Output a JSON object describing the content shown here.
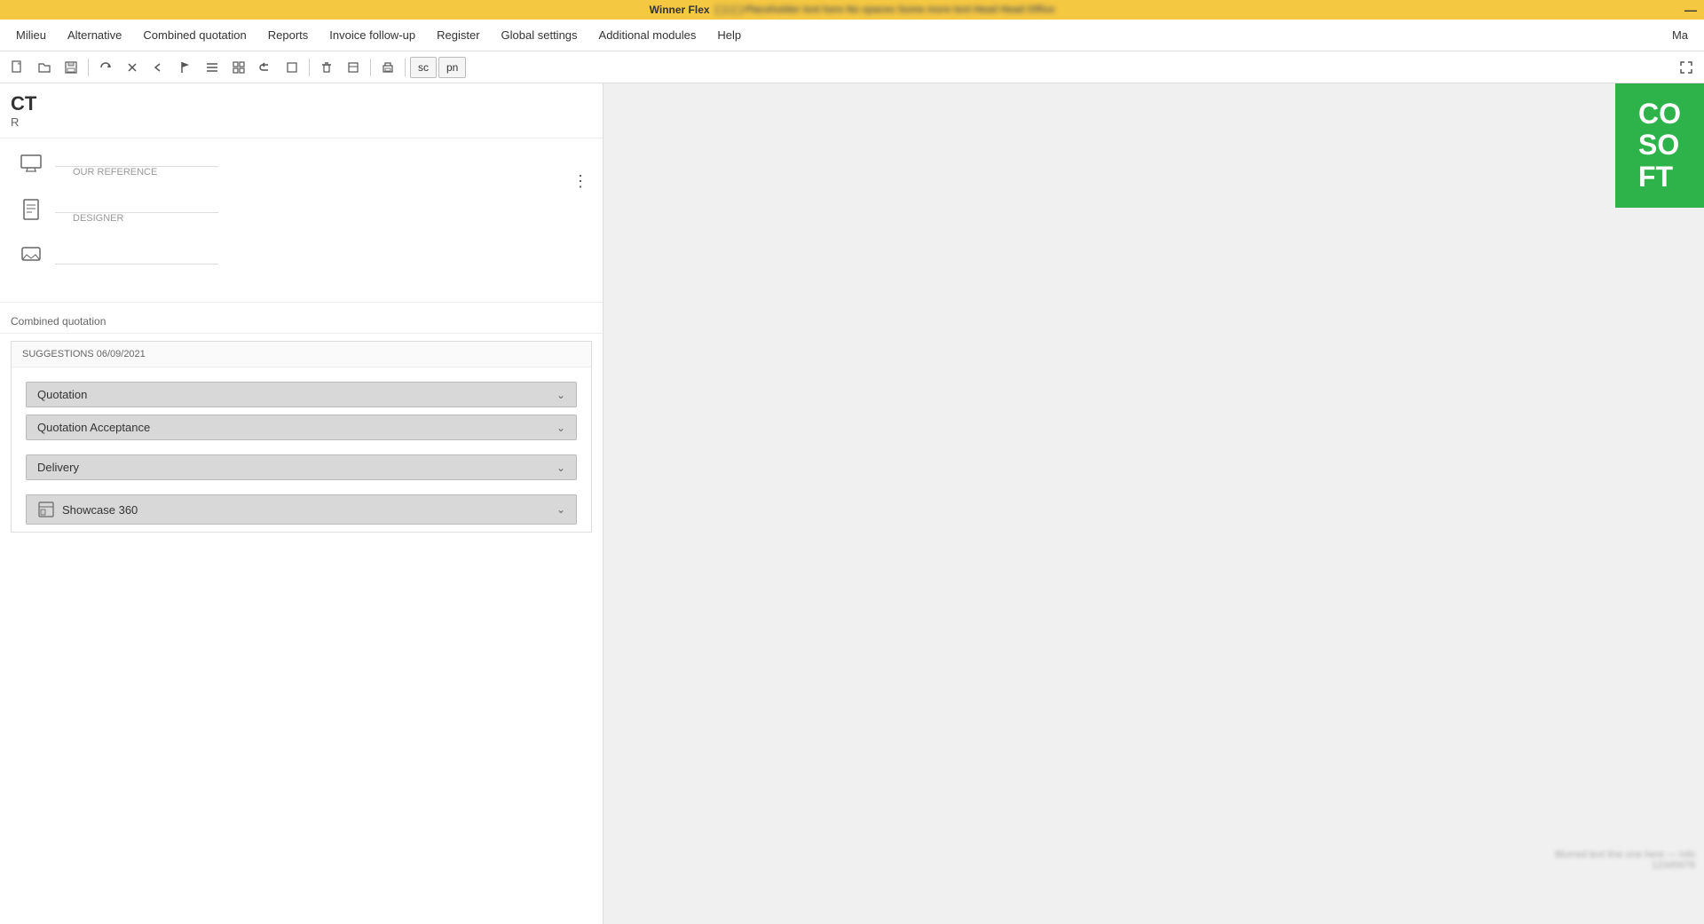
{
  "titlebar": {
    "text": "Winner Flex",
    "extra": "[ ] | [           ]   Placeholder text here   No spaces   Some more text   Head   Head Office",
    "close": "—"
  },
  "menubar": {
    "items": [
      {
        "id": "milieu",
        "label": "Milieu"
      },
      {
        "id": "alternative",
        "label": "Alternative"
      },
      {
        "id": "combined-quotation",
        "label": "Combined quotation"
      },
      {
        "id": "reports",
        "label": "Reports"
      },
      {
        "id": "invoice-follow-up",
        "label": "Invoice follow-up"
      },
      {
        "id": "register",
        "label": "Register"
      },
      {
        "id": "global-settings",
        "label": "Global settings"
      },
      {
        "id": "additional-modules",
        "label": "Additional modules"
      },
      {
        "id": "help",
        "label": "Help"
      },
      {
        "id": "ma",
        "label": "Ma"
      }
    ]
  },
  "toolbar": {
    "buttons": [
      {
        "id": "new",
        "icon": "📄"
      },
      {
        "id": "open",
        "icon": "📂"
      },
      {
        "id": "save",
        "icon": "💾"
      },
      {
        "id": "btn5",
        "icon": "🔄"
      },
      {
        "id": "btn6",
        "icon": "✂"
      },
      {
        "id": "btn7",
        "icon": "⬅"
      },
      {
        "id": "btn8",
        "icon": "🚩"
      },
      {
        "id": "btn9",
        "icon": "≡"
      },
      {
        "id": "btn10",
        "icon": "⬜"
      },
      {
        "id": "btn11",
        "icon": "↩"
      },
      {
        "id": "btn12",
        "icon": "⬜"
      },
      {
        "id": "btn13",
        "icon": "🗑"
      },
      {
        "id": "btn14",
        "icon": "⬜"
      },
      {
        "id": "btn15",
        "icon": "🖨"
      },
      {
        "id": "sc",
        "label": "sc"
      },
      {
        "id": "pn",
        "label": "pn"
      },
      {
        "id": "expand",
        "icon": "⬜"
      }
    ]
  },
  "header": {
    "ct_label": "CT",
    "r_label": "R",
    "our_reference_label": "OUR REFERENCE",
    "designer_label": "DESIGNER"
  },
  "form": {
    "rows": [
      {
        "icon": "monitor",
        "field_value": "",
        "field_label": "OUR REFERENCE"
      },
      {
        "icon": "document",
        "field_value": "",
        "field_label": "DESIGNER"
      },
      {
        "icon": "message",
        "field_value": "",
        "field_label": ""
      }
    ]
  },
  "combined_label": "Combined quotation",
  "suggestions": {
    "header": "SUGGESTIONS 06/09/2021",
    "items": [
      {
        "id": "quotation",
        "label": "Quotation",
        "has_icon": false
      },
      {
        "id": "quotation-acceptance",
        "label": "Quotation Acceptance",
        "has_icon": false
      },
      {
        "id": "delivery",
        "label": "Delivery",
        "has_icon": false
      },
      {
        "id": "showcase-360",
        "label": "Showcase 360",
        "has_icon": true
      }
    ]
  },
  "logo": {
    "text": "CO\nSO\nFT",
    "bg_color": "#2db34a"
  },
  "blurred_text": {
    "line1": "Blurred text line one here — info",
    "line2": "12345678"
  }
}
